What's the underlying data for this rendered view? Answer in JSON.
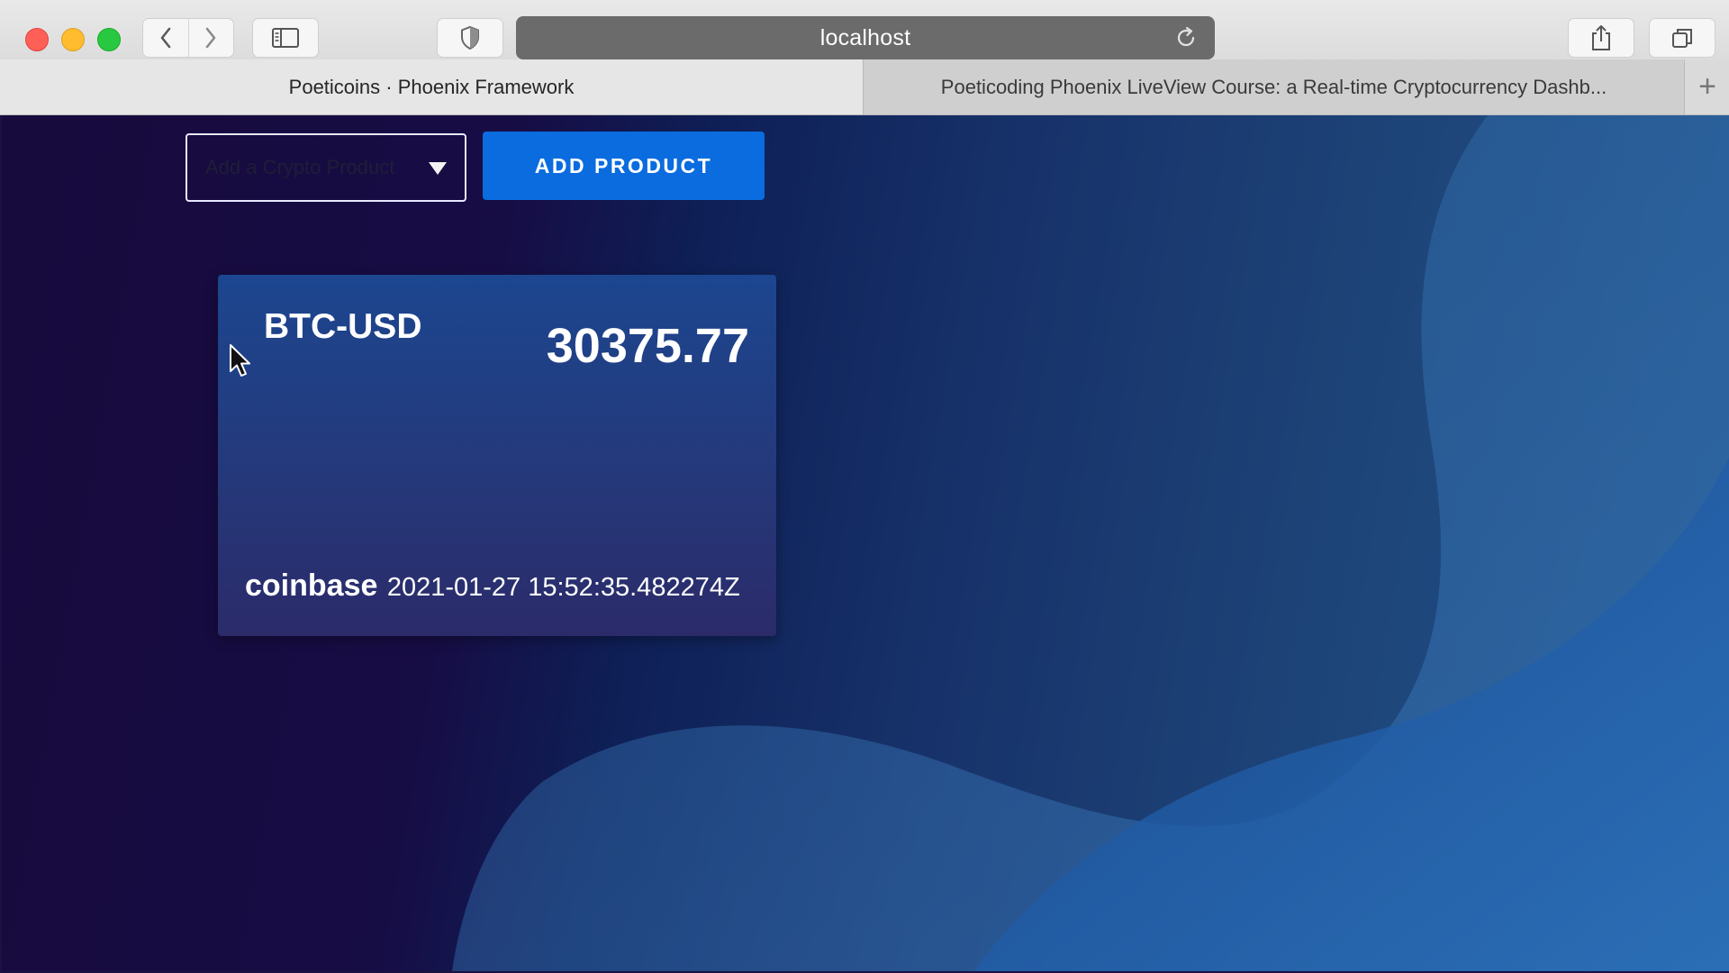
{
  "browser": {
    "url": "localhost",
    "tabs": [
      {
        "label": "Poeticoins · Phoenix Framework",
        "active": true
      },
      {
        "label": "Poeticoding Phoenix LiveView Course: a Real-time Cryptocurrency Dashb...",
        "active": false
      }
    ],
    "new_tab_label": "+"
  },
  "toolbar": {
    "product_select": {
      "value": "Add a Crypto Product"
    },
    "add_button_label": "ADD PRODUCT"
  },
  "cards": [
    {
      "pair": "BTC-USD",
      "price": "30375.77",
      "exchange": "coinbase",
      "timestamp": "2021-01-27 15:52:35.482274Z"
    }
  ],
  "colors": {
    "accent": "#0a6cdf",
    "card_top": "#1c4690",
    "card_bottom": "#2b2b6a",
    "page_dark": "#170a3c",
    "page_light": "#22568e"
  },
  "icons": {
    "window_controls": [
      "close-icon",
      "minimize-icon",
      "zoom-icon"
    ],
    "toolbar": [
      "back-icon",
      "forward-icon",
      "sidebar-icon",
      "shield-icon",
      "reload-icon",
      "share-icon",
      "tabs-overview-icon"
    ]
  }
}
